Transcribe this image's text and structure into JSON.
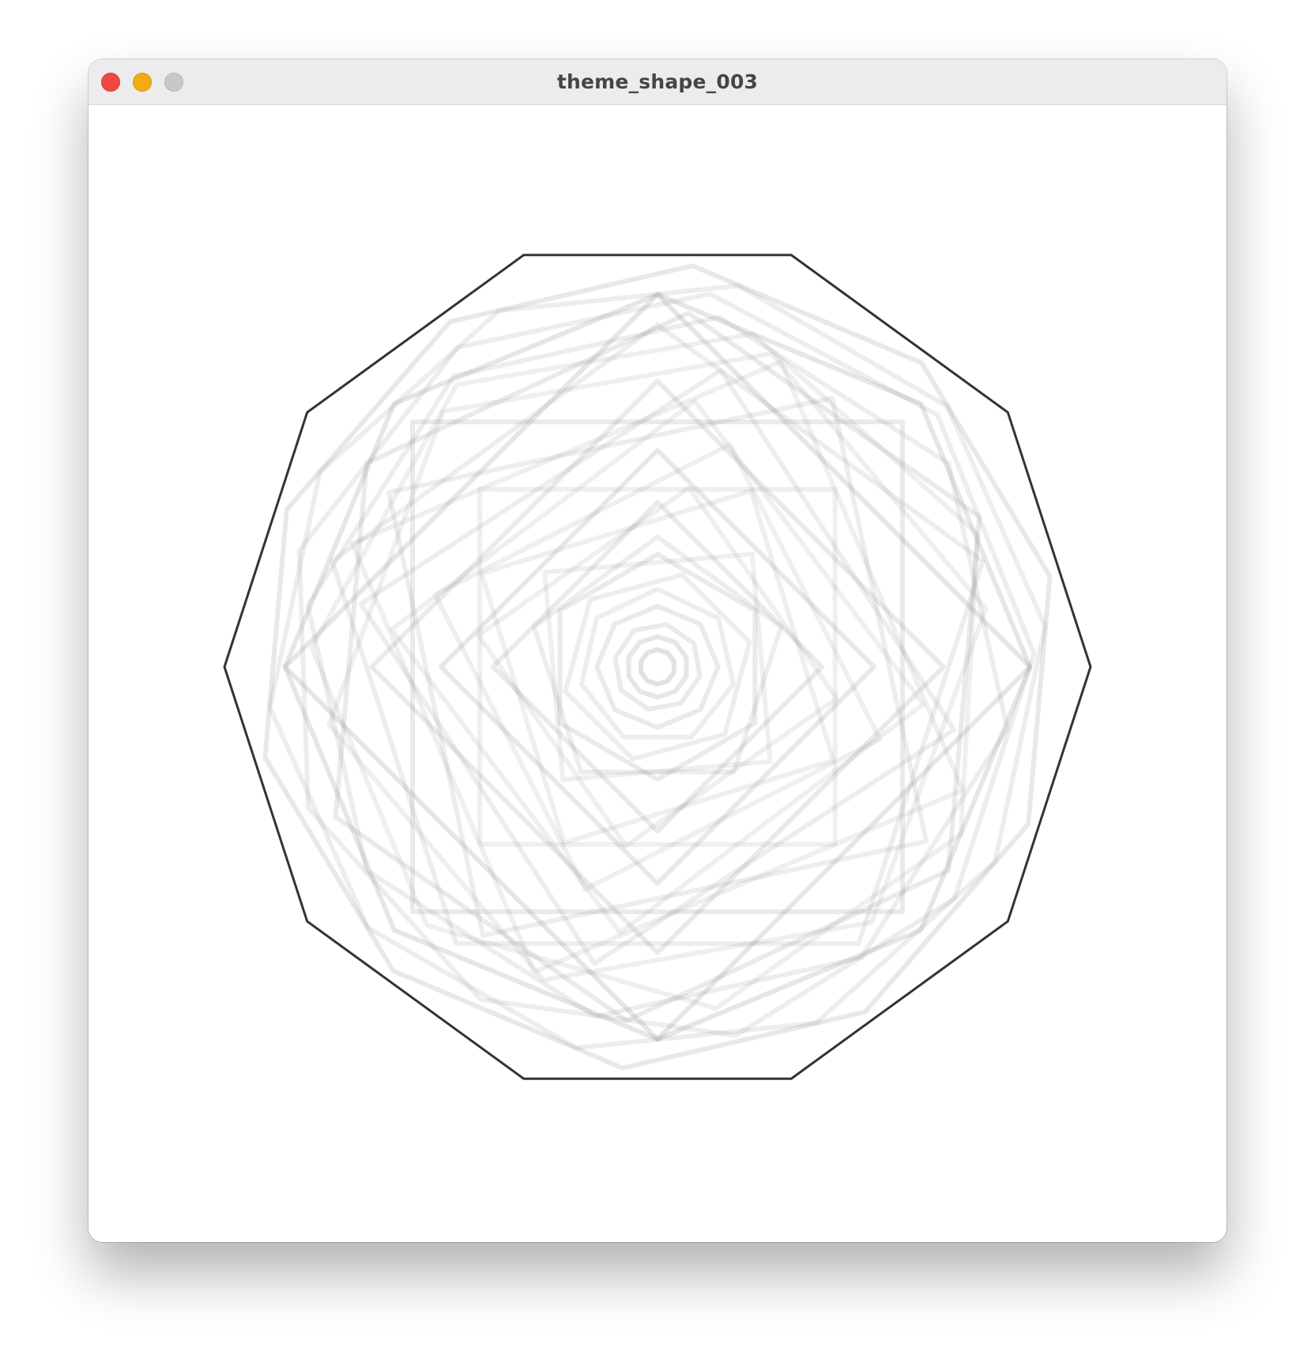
{
  "window": {
    "title": "theme_shape_003",
    "controls": {
      "close": "close-button",
      "minimize": "minimize-button",
      "zoom": "zoom-button"
    }
  },
  "colors": {
    "titlebar_bg": "#ececec",
    "canvas_bg": "#ffffff",
    "outline_stroke": "#333333",
    "ghost_stroke": "#8c8c8c",
    "close": "#ee4a43",
    "minimize": "#f2ac13",
    "zoom": "#c8c8c8"
  },
  "artwork": {
    "outer_polygon_sides": 10,
    "ghost_layers": [
      {
        "sides": 10,
        "rel_size": 0.93,
        "rot_deg": 5,
        "opacity": 0.2
      },
      {
        "sides": 10,
        "rel_size": 0.9,
        "rot_deg": 12,
        "opacity": 0.16
      },
      {
        "sides": 9,
        "rel_size": 0.87,
        "rot_deg": 8,
        "opacity": 0.16
      },
      {
        "sides": 8,
        "rel_size": 0.86,
        "rot_deg": 0,
        "opacity": 0.22
      },
      {
        "sides": 8,
        "rel_size": 0.82,
        "rot_deg": 10,
        "opacity": 0.16
      },
      {
        "sides": 7,
        "rel_size": 0.8,
        "rot_deg": 16,
        "opacity": 0.14
      },
      {
        "sides": 6,
        "rel_size": 0.82,
        "rot_deg": 5,
        "opacity": 0.18
      },
      {
        "sides": 6,
        "rel_size": 0.77,
        "rot_deg": 20,
        "opacity": 0.14
      },
      {
        "sides": 5,
        "rel_size": 0.79,
        "rot_deg": 0,
        "opacity": 0.16
      },
      {
        "sides": 4,
        "rel_size": 0.86,
        "rot_deg": 0,
        "opacity": 0.22
      },
      {
        "sides": 4,
        "rel_size": 0.8,
        "rot_deg": 45,
        "opacity": 0.18
      },
      {
        "sides": 4,
        "rel_size": 0.76,
        "rot_deg": 22,
        "opacity": 0.14
      },
      {
        "sides": 4,
        "rel_size": 0.74,
        "rot_deg": 33,
        "opacity": 0.16
      },
      {
        "sides": 4,
        "rel_size": 0.7,
        "rot_deg": 12,
        "opacity": 0.16
      },
      {
        "sides": 4,
        "rel_size": 0.66,
        "rot_deg": 0,
        "opacity": 0.18
      },
      {
        "sides": 4,
        "rel_size": 0.62,
        "rot_deg": 8,
        "opacity": 0.14
      },
      {
        "sides": 4,
        "rel_size": 0.58,
        "rot_deg": 45,
        "opacity": 0.14
      },
      {
        "sides": 4,
        "rel_size": 0.54,
        "rot_deg": 18,
        "opacity": 0.14
      },
      {
        "sides": 4,
        "rel_size": 0.5,
        "rot_deg": 0,
        "opacity": 0.2
      },
      {
        "sides": 4,
        "rel_size": 0.46,
        "rot_deg": 28,
        "opacity": 0.14
      },
      {
        "sides": 4,
        "rel_size": 0.42,
        "rot_deg": 10,
        "opacity": 0.14
      },
      {
        "sides": 4,
        "rel_size": 0.38,
        "rot_deg": 0,
        "opacity": 0.18
      },
      {
        "sides": 4,
        "rel_size": 0.34,
        "rot_deg": 40,
        "opacity": 0.14
      },
      {
        "sides": 5,
        "rel_size": 0.3,
        "rot_deg": 0,
        "opacity": 0.16
      },
      {
        "sides": 6,
        "rel_size": 0.26,
        "rot_deg": 0,
        "opacity": 0.18
      },
      {
        "sides": 6,
        "rel_size": 0.22,
        "rot_deg": 15,
        "opacity": 0.16
      },
      {
        "sides": 7,
        "rel_size": 0.18,
        "rot_deg": 0,
        "opacity": 0.16
      },
      {
        "sides": 8,
        "rel_size": 0.14,
        "rot_deg": 0,
        "opacity": 0.18
      },
      {
        "sides": 8,
        "rel_size": 0.1,
        "rot_deg": 12,
        "opacity": 0.18
      },
      {
        "sides": 10,
        "rel_size": 0.07,
        "rot_deg": 0,
        "opacity": 0.22
      },
      {
        "sides": 10,
        "rel_size": 0.04,
        "rot_deg": 0,
        "opacity": 0.26
      }
    ]
  }
}
